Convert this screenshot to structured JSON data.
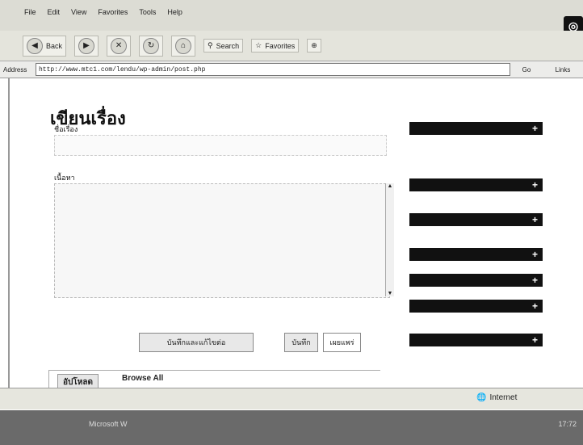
{
  "browser": {
    "menu": [
      "File",
      "Edit",
      "View",
      "Favorites",
      "Tools",
      "Help"
    ],
    "toolbar": {
      "back_label": "Back",
      "search_label": "Search",
      "favorites_label": "Favorites"
    },
    "address": {
      "label": "Address",
      "url": "http://www.mtc1.com/lendu/wp-admin/post.php",
      "go_label": "Go",
      "links_label": "Links"
    },
    "status": {
      "zone": "Internet"
    },
    "taskbar": {
      "item": "Microsoft W",
      "clock": "17:72"
    }
  },
  "page": {
    "title": "เขียนเรื่อง",
    "title_label": "ชื่อเรื่อง",
    "content_label": "เนื้อหา",
    "buttons": {
      "primary": "บันทึกและแก้ไขต่อ",
      "save": "บันทึก",
      "publish": "เผยแพร่"
    },
    "panels": [
      "",
      "",
      "",
      "",
      "",
      "",
      ""
    ],
    "bottom_tabs": {
      "active": "อัปโหลด",
      "browse": "Browse All"
    }
  },
  "colors": {
    "panel_bg": "#111111",
    "page_bg": "#ffffff"
  }
}
